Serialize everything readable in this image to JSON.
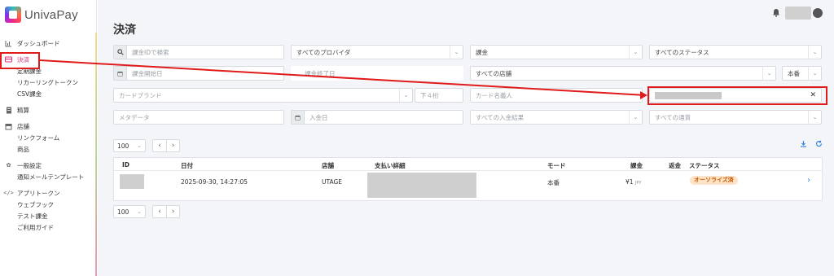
{
  "brand": {
    "name": "UnivaPay"
  },
  "sidebar": {
    "groups": [
      {
        "label": "ダッシュボード",
        "icon": "chart-icon",
        "items": []
      },
      {
        "label": "決済",
        "icon": "card-icon",
        "active": true,
        "items": [
          "定期課金",
          "リカーリングトークン",
          "CSV課金"
        ]
      },
      {
        "label": "精算",
        "icon": "document-icon",
        "items": []
      },
      {
        "label": "店舗",
        "icon": "store-icon",
        "items": [
          "リンクフォーム",
          "商品"
        ]
      },
      {
        "label": "一般設定",
        "icon": "gear-icon",
        "items": [
          "通知メールテンプレート"
        ]
      },
      {
        "label": "アプリトークン",
        "icon": "code-icon",
        "items": [
          "ウェブフック",
          "テスト課金",
          "ご利用ガイド"
        ]
      }
    ]
  },
  "header": {
    "title": "決済"
  },
  "filters": {
    "search_placeholder": "課金IDで検索",
    "provider": "すべてのプロバイダ",
    "charge_type": "課金",
    "status": "すべてのステータス",
    "start_date_placeholder": "課金開始日",
    "end_date_placeholder": "課金終了日",
    "store": "すべての店舗",
    "mode": "本番",
    "card_brand_placeholder": "カードブランド",
    "last4_placeholder": "下４桁",
    "cardholder_placeholder": "カード名義人",
    "metadata_placeholder": "メタデータ",
    "deposit_date_placeholder": "入金日",
    "deposit_result": "すべての入金結果",
    "currency": "すべての通貨"
  },
  "pagination": {
    "per_page": "100"
  },
  "table": {
    "headers": [
      "ID",
      "日付",
      "店舗",
      "支払い詳細",
      "モード",
      "課金",
      "返金",
      "ステータス"
    ],
    "rows": [
      {
        "date": "2025-09-30, 14:27:05",
        "store": "UTAGE",
        "mode": "本番",
        "amount": "¥1",
        "currency": "JPY",
        "status": "オーソライズ済"
      }
    ]
  },
  "colors": {
    "accent": "#e2337d",
    "highlight": "#e01b1b",
    "link": "#3a86d6",
    "badge_bg": "#fde3c8",
    "badge_text": "#c85a00"
  }
}
